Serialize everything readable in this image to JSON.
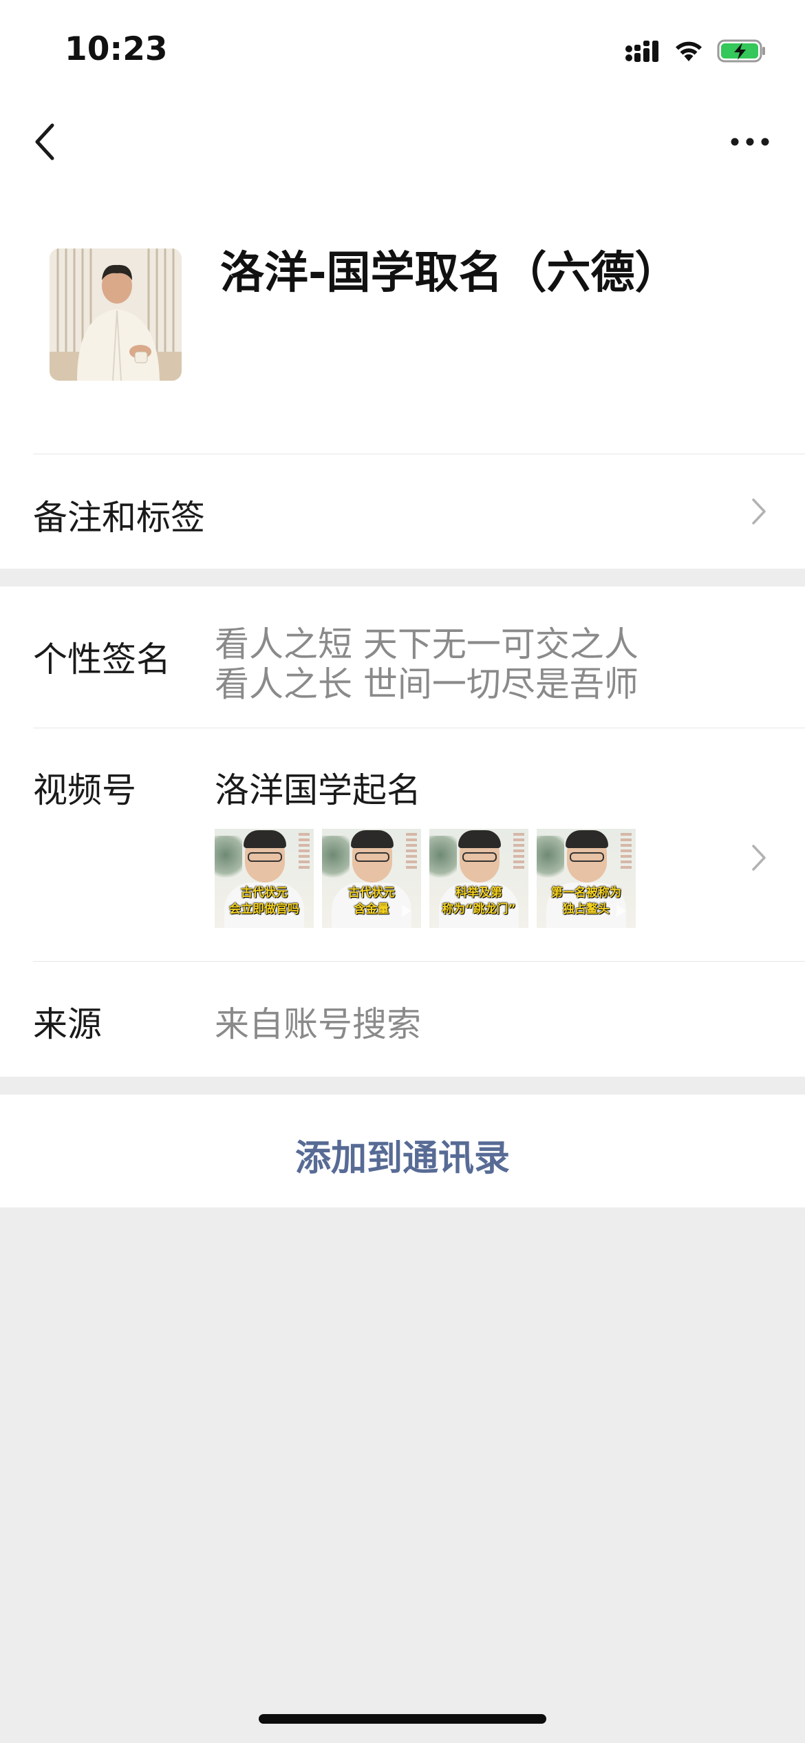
{
  "status_bar": {
    "time": "10:23"
  },
  "nav": {
    "back_icon": "chevron-left-icon",
    "more_icon": "more-dots-icon"
  },
  "profile": {
    "name": "洛洋-国学取名（六德）"
  },
  "remark_row": {
    "label": "备注和标签"
  },
  "signature": {
    "label": "个性签名",
    "lines": [
      "看人之短  天下无一可交之人",
      "看人之长  世间一切尽是吾师"
    ]
  },
  "channels": {
    "label": "视频号",
    "name": "洛洋国学起名",
    "videos": [
      {
        "caption_line1": "古代状元",
        "caption_line2": "会立即做官吗"
      },
      {
        "caption_line1": "古代状元",
        "caption_line2": "含金量"
      },
      {
        "caption_line1": "科举及第",
        "caption_line2": "称为“跳龙门”"
      },
      {
        "caption_line1": "第一名被称为",
        "caption_line2": "独占鳌头"
      }
    ]
  },
  "source": {
    "label": "来源",
    "value": "来自账号搜索"
  },
  "actions": {
    "add_contact": "添加到通讯录"
  },
  "colors": {
    "link_blue": "#576b95",
    "battery_green": "#34c759",
    "page_bg": "#ededed"
  }
}
